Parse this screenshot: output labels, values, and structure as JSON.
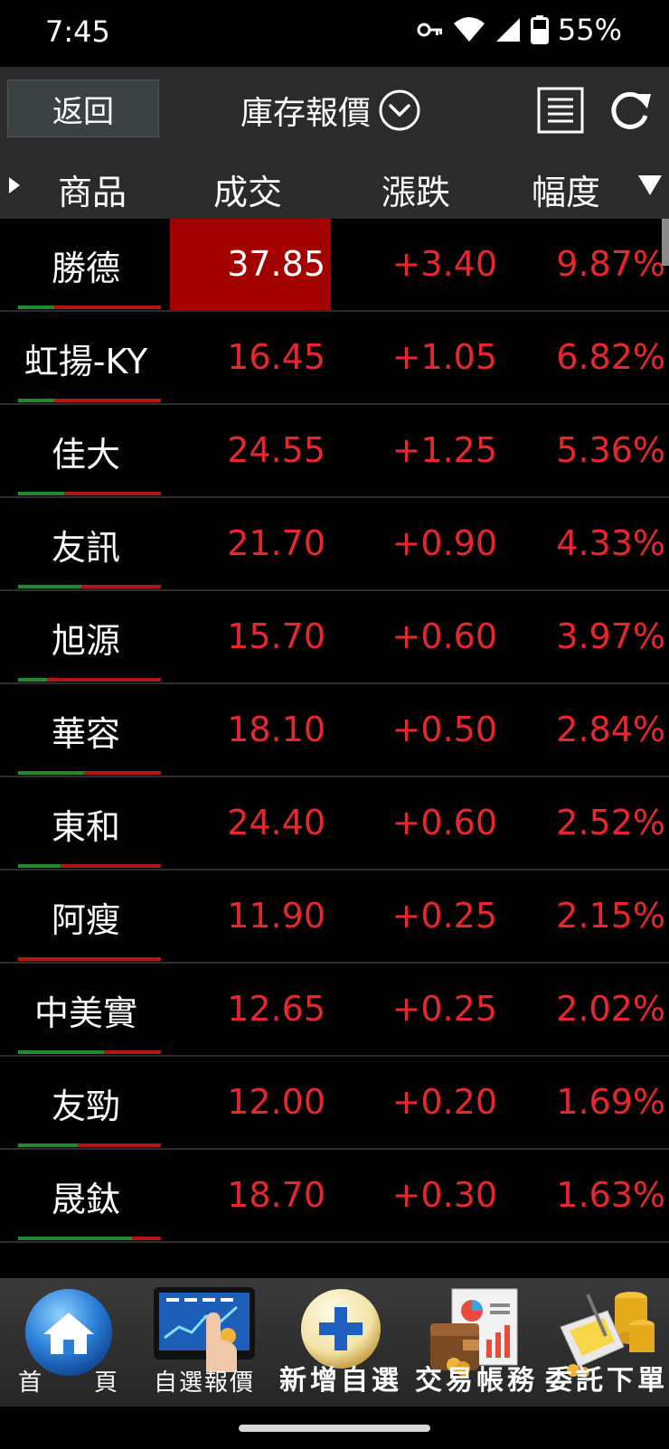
{
  "status": {
    "time": "7:45",
    "battery": "55%",
    "icons": [
      "key-icon",
      "wifi-icon",
      "signal-icon",
      "battery-icon"
    ]
  },
  "toolbar": {
    "back_label": "返回",
    "title": "庫存報價",
    "dropdown_icon": "chevron-down-circle-icon",
    "list_icon": "list-view-icon",
    "refresh_icon": "refresh-icon"
  },
  "columns": {
    "name": "商品",
    "price": "成交",
    "change": "漲跌",
    "percent": "幅度"
  },
  "colors": {
    "up": "#e8262e",
    "flash": "#a30000",
    "bar_green": "#1f8b2e",
    "bar_red": "#b11515"
  },
  "rows": [
    {
      "name": "勝德",
      "price": "37.85",
      "change": "+3.40",
      "percent": "9.87%",
      "flash": true,
      "green_fraction": 0.25
    },
    {
      "name": "虹揚-KY",
      "price": "16.45",
      "change": "+1.05",
      "percent": "6.82%",
      "flash": false,
      "green_fraction": 0.25
    },
    {
      "name": "佳大",
      "price": "24.55",
      "change": "+1.25",
      "percent": "5.36%",
      "flash": false,
      "green_fraction": 0.32
    },
    {
      "name": "友訊",
      "price": "21.70",
      "change": "+0.90",
      "percent": "4.33%",
      "flash": false,
      "green_fraction": 0.44
    },
    {
      "name": "旭源",
      "price": "15.70",
      "change": "+0.60",
      "percent": "3.97%",
      "flash": false,
      "green_fraction": 0.2
    },
    {
      "name": "華容",
      "price": "18.10",
      "change": "+0.50",
      "percent": "2.84%",
      "flash": false,
      "green_fraction": 0.46
    },
    {
      "name": "東和",
      "price": "24.40",
      "change": "+0.60",
      "percent": "2.52%",
      "flash": false,
      "green_fraction": 0.3
    },
    {
      "name": "阿瘦",
      "price": "11.90",
      "change": "+0.25",
      "percent": "2.15%",
      "flash": false,
      "green_fraction": 0.0
    },
    {
      "name": "中美實",
      "price": "12.65",
      "change": "+0.25",
      "percent": "2.02%",
      "flash": false,
      "green_fraction": 0.6
    },
    {
      "name": "友勁",
      "price": "12.00",
      "change": "+0.20",
      "percent": "1.69%",
      "flash": false,
      "green_fraction": 0.42
    },
    {
      "name": "晟鈦",
      "price": "18.70",
      "change": "+0.30",
      "percent": "1.63%",
      "flash": false,
      "green_fraction": 0.8
    }
  ],
  "nav": {
    "home_chars": [
      "首",
      "頁"
    ],
    "watchlist": "自選報價",
    "add_watch": "新增自選",
    "account": "交易帳務",
    "order": "委託下單"
  }
}
